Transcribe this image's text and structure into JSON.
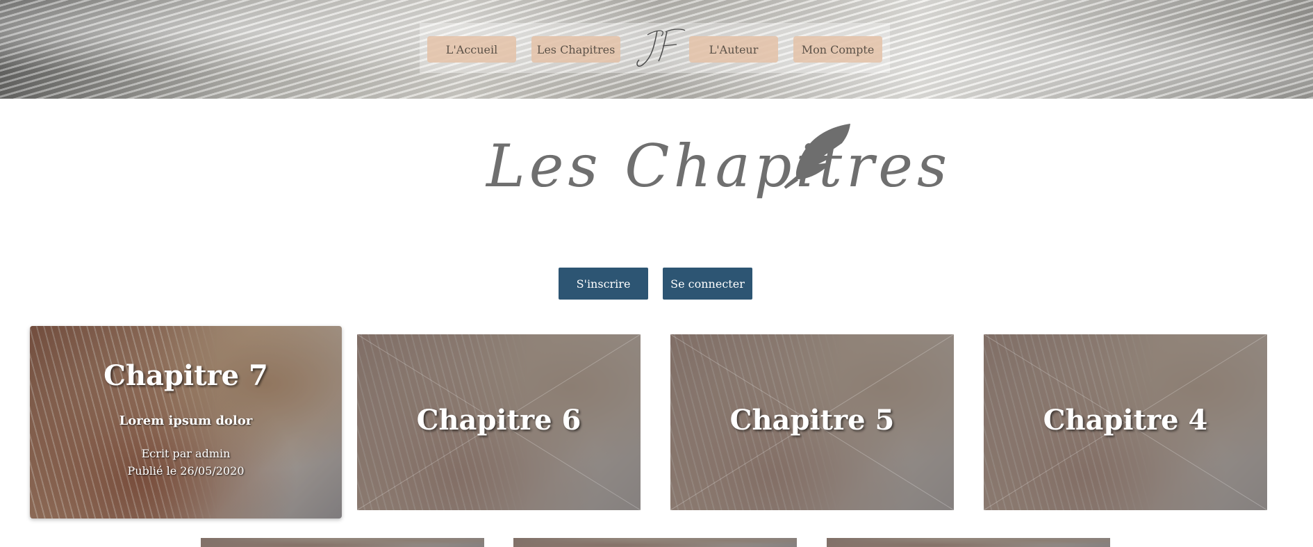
{
  "header": {
    "nav": [
      {
        "label": "L'Accueil"
      },
      {
        "label": "Les Chapitres"
      },
      {
        "label": "L'Auteur"
      },
      {
        "label": "Mon Compte"
      }
    ],
    "logo_text": "JF",
    "logo_icon": "signature-logo"
  },
  "page": {
    "title": "Les Chapitres",
    "title_icon": "quill-icon"
  },
  "auth": {
    "signup_label": "S'inscrire",
    "login_label": "Se connecter"
  },
  "chapters": {
    "featured": {
      "title": "Chapitre 7",
      "excerpt": "Lorem ipsum dolor",
      "author": "Ecrit par admin",
      "published": "Publié le 26/05/2020"
    },
    "cards": [
      {
        "title": "Chapitre 6"
      },
      {
        "title": "Chapitre 5"
      },
      {
        "title": "Chapitre 4"
      }
    ],
    "next_row_count": 3
  },
  "colors": {
    "nav_button": "#e4c3aa",
    "auth_button": "#2d5573",
    "title_gray": "#6f6f6f"
  }
}
